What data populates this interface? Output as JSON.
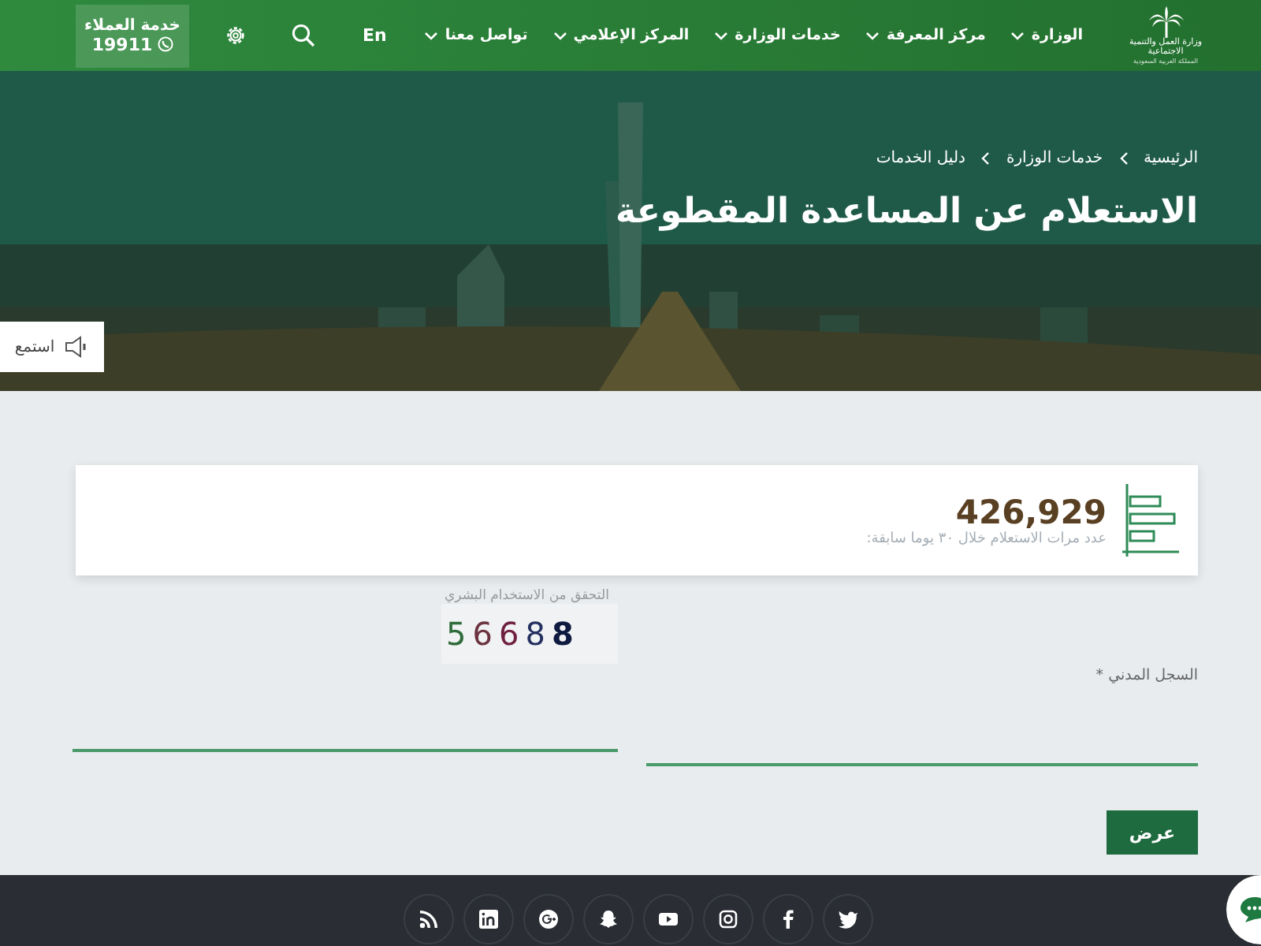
{
  "header": {
    "logo": {
      "name": "وزارة العمل والتنمية الاجتماعية",
      "country": "المملكة العربية السعودية"
    },
    "nav": [
      {
        "label": "الوزارة",
        "has_dropdown": true
      },
      {
        "label": "مركز المعرفة",
        "has_dropdown": true
      },
      {
        "label": "خدمات الوزارة",
        "has_dropdown": true
      },
      {
        "label": "المركز الإعلامي",
        "has_dropdown": true
      },
      {
        "label": "تواصل معنا",
        "has_dropdown": true
      }
    ],
    "language": "En",
    "customer_service": {
      "label": "خدمة العملاء",
      "phone": "19911"
    }
  },
  "hero": {
    "breadcrumb": [
      "الرئيسية",
      "خدمات الوزارة",
      "دليل الخدمات"
    ],
    "title": "الاستعلام عن المساعدة المقطوعة",
    "listen": "استمع"
  },
  "stats": {
    "value": "426,929",
    "caption": "عدد مرات الاستعلام خلال ٣٠ يوما سابقة:"
  },
  "form": {
    "national_id_label": "السجل المدني *",
    "captcha_label": "التحقق من الاستخدام البشري",
    "captcha_code": "56688",
    "submit": "عرض"
  }
}
